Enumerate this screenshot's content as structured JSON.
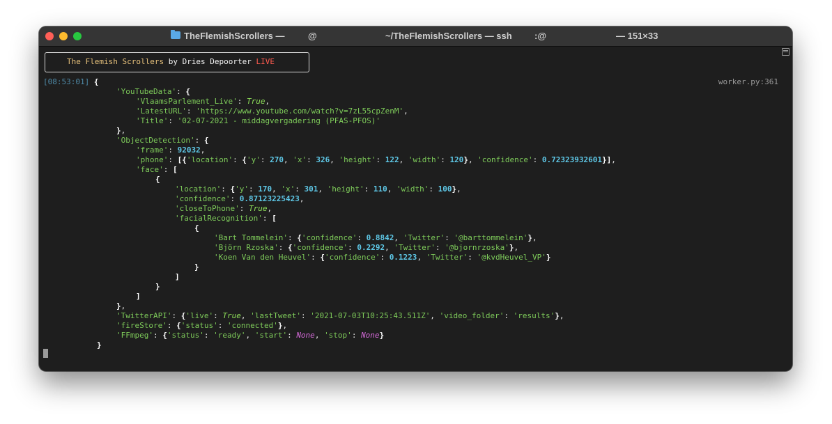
{
  "window": {
    "title_app": "TheFlemishScrollers —",
    "title_host": "@",
    "title_path": "~/TheFlemishScrollers — ssh",
    "title_host2": ":@",
    "title_size": "— 151×33"
  },
  "banner": {
    "name": "The Flemish Scrollers",
    "by": " by Dries Depoorter ",
    "live": "LIVE"
  },
  "log": {
    "timestamp": "[08:53:01]",
    "source": "worker.py:361"
  },
  "json": {
    "k_youtube": "'YouTubeData'",
    "k_vlaams": "'VlaamsParlement_Live'",
    "v_true": "True",
    "k_latesturl": "'LatestURL'",
    "v_url": "'https://www.youtube.com/watch?v=7zL55cpZenM'",
    "k_title": "'Title'",
    "v_title": "'02-07-2021 - middagvergadering (PFAS-PFOS)'",
    "k_objdet": "'ObjectDetection'",
    "k_frame": "'frame'",
    "v_frame": "92032",
    "k_phone": "'phone'",
    "k_location": "'location'",
    "k_y": "'y'",
    "k_x": "'x'",
    "k_height": "'height'",
    "k_width": "'width'",
    "k_confidence": "'confidence'",
    "phone_y": "270",
    "phone_x": "326",
    "phone_h": "122",
    "phone_w": "120",
    "phone_conf": "0.72323932601",
    "k_face": "'face'",
    "face_y": "170",
    "face_x": "301",
    "face_h": "110",
    "face_w": "100",
    "face_conf": "0.87123225423",
    "k_close": "'closeToPhone'",
    "k_facial": "'facialRecognition'",
    "k_twitter": "'Twitter'",
    "p1_name": "'Bart Tommelein'",
    "p1_conf": "0.8842",
    "p1_tw": "'@barttommelein'",
    "p2_name": "'Björn Rzoska'",
    "p2_conf": "0.2292",
    "p2_tw": "'@bjornrzoska'",
    "p3_name": "'Koen Van den Heuvel'",
    "p3_conf": "0.1223",
    "p3_tw": "'@kvdHeuvel_VP'",
    "k_twitterapi": "'TwitterAPI'",
    "k_live": "'live'",
    "k_lasttweet": "'lastTweet'",
    "v_lasttweet": "'2021-07-03T10:25:43.511Z'",
    "k_videofolder": "'video_folder'",
    "v_results": "'results'",
    "k_firestore": "'fireStore'",
    "k_status": "'status'",
    "v_connected": "'connected'",
    "k_ffmpeg": "'FFmpeg'",
    "v_ready": "'ready'",
    "k_start": "'start'",
    "v_none": "None",
    "k_stop": "'stop'"
  },
  "colors": {
    "close": "#ff5f57",
    "minimize": "#febc2e",
    "zoom": "#28c840",
    "string": "#7ecb5a",
    "number": "#5ec7e6",
    "none": "#d46ad8"
  }
}
